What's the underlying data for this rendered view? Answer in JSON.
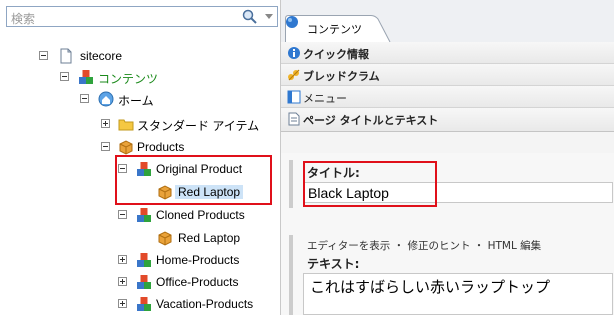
{
  "search": {
    "placeholder": "検索"
  },
  "tree": {
    "root": "sitecore",
    "content": "コンテンツ",
    "home": "ホーム",
    "standard_items": "スタンダード アイテム",
    "products": "Products",
    "original_product": "Original Product",
    "red_laptop_1": "Red Laptop",
    "cloned_products": "Cloned Products",
    "red_laptop_2": "Red Laptop",
    "home_products": "Home-Products",
    "office_products": "Office-Products",
    "vacation_products": "Vacation-Products"
  },
  "editor": {
    "tab_label": "コンテンツ",
    "sections": [
      {
        "label": "クイック情報",
        "icon": "info-icon"
      },
      {
        "label": "ブレッドクラム",
        "icon": "breadcrumb-icon"
      },
      {
        "label": "メニュー",
        "icon": "menu-icon"
      },
      {
        "label": "ページ タイトルとテキスト",
        "icon": "page-icon"
      }
    ],
    "title_label": "タイトル:",
    "title_value": "Black Laptop",
    "editor_links": "エディターを表示 ・ 修正のヒント ・ HTML 編集",
    "text_label": "テキスト:",
    "text_value": "これはすばらしい赤いラップトップ"
  },
  "colors": {
    "highlight": "#e0101a",
    "content_green": "#1b8a1b",
    "selection": "#cde3f7"
  }
}
